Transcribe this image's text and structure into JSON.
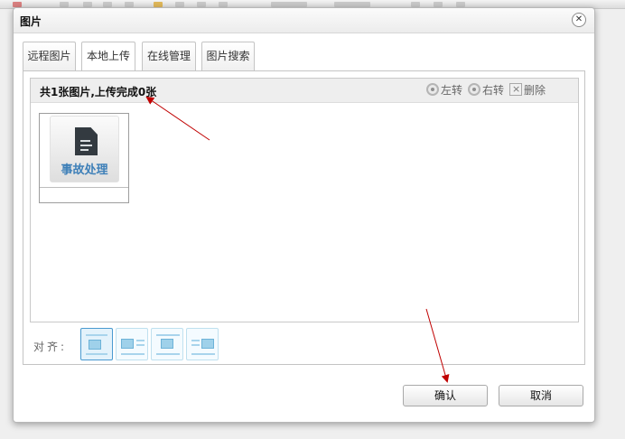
{
  "dialog": {
    "title": "图片",
    "close_icon": "close-icon"
  },
  "tabs": [
    {
      "label": "远程图片",
      "active": false
    },
    {
      "label": "本地上传",
      "active": true
    },
    {
      "label": "在线管理",
      "active": false
    },
    {
      "label": "图片搜索",
      "active": false
    }
  ],
  "upload": {
    "status": "共1张图片,上传完成0张",
    "rotate_left": "左转",
    "rotate_right": "右转",
    "delete": "删除"
  },
  "thumbnail": {
    "label": "事故处理",
    "icon": "document-icon"
  },
  "align": {
    "label": "对齐:",
    "options": [
      "align-none",
      "align-left",
      "align-center",
      "align-right"
    ]
  },
  "buttons": {
    "confirm": "确认",
    "cancel": "取消"
  },
  "colors": {
    "annotation_arrow": "#c00000",
    "thumbnail_text": "#3d7fb8",
    "align_active_border": "#4a9ad0"
  }
}
